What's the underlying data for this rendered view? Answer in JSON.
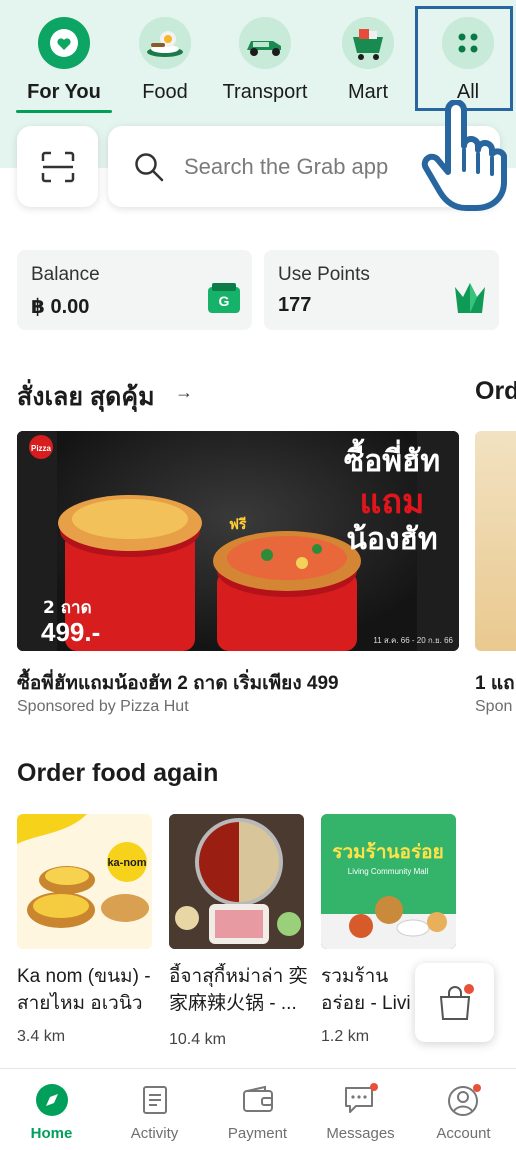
{
  "categories": [
    {
      "label": "For You",
      "icon": "heart-icon",
      "active": true
    },
    {
      "label": "Food",
      "icon": "food-plate-icon",
      "active": false
    },
    {
      "label": "Transport",
      "icon": "car-icon",
      "active": false
    },
    {
      "label": "Mart",
      "icon": "cart-icon",
      "active": false
    },
    {
      "label": "All",
      "icon": "grid-dots-icon",
      "active": false
    }
  ],
  "search": {
    "placeholder": "Search the Grab app"
  },
  "wallet": {
    "balance_label": "Balance",
    "balance_value": "฿ 0.00",
    "points_label": "Use Points",
    "points_value": "177"
  },
  "promo_section": {
    "title": "สั่งเลย สุดคุ้ม",
    "next_title": "Ord",
    "items": [
      {
        "title": "ซื้อพี่ฮัทแถมน้องฮัท 2 ถาด เริ่มเพียง 499",
        "sponsor": "Sponsored by Pizza Hut",
        "banner_headline_1": "ซื้อพี่ฮัท",
        "banner_headline_2": "แถม",
        "banner_headline_3": "น้องฮัท",
        "banner_price_prefix": "2 ถาด",
        "banner_price": "499.-",
        "banner_free": "ฟรี",
        "banner_date": "11 ส.ค. 66 - 20 ก.ย. 66"
      },
      {
        "title": "1 แถ",
        "sponsor": "Spon"
      }
    ]
  },
  "order_again": {
    "title": "Order food again",
    "items": [
      {
        "name_line1": "Ka nom (ขนม) -",
        "name_line2": "สายไหม อเวนิว",
        "distance": "3.4 km",
        "logo_text": "ka-nom"
      },
      {
        "name_line1": "อี้จาสุกี้หม่าล่า 奕",
        "name_line2": "家麻辣火锅 - ...",
        "distance": "10.4 km"
      },
      {
        "name_line1": "รวมร้าน",
        "name_line2": "อร่อย - Livi",
        "distance": "1.2 km",
        "banner_text": "รวมร้านอร่อย",
        "banner_sub": "Living Community Mall"
      }
    ]
  },
  "bottom_nav": [
    {
      "label": "Home",
      "icon": "compass-icon",
      "active": true
    },
    {
      "label": "Activity",
      "icon": "receipt-icon",
      "active": false
    },
    {
      "label": "Payment",
      "icon": "wallet-icon",
      "active": false
    },
    {
      "label": "Messages",
      "icon": "chat-icon",
      "active": false,
      "badge": true
    },
    {
      "label": "Account",
      "icon": "account-icon",
      "active": false,
      "badge": true
    }
  ],
  "colors": {
    "brand_green": "#00a05a",
    "highlight_blue": "#2866a0",
    "badge_red": "#e8503a"
  }
}
